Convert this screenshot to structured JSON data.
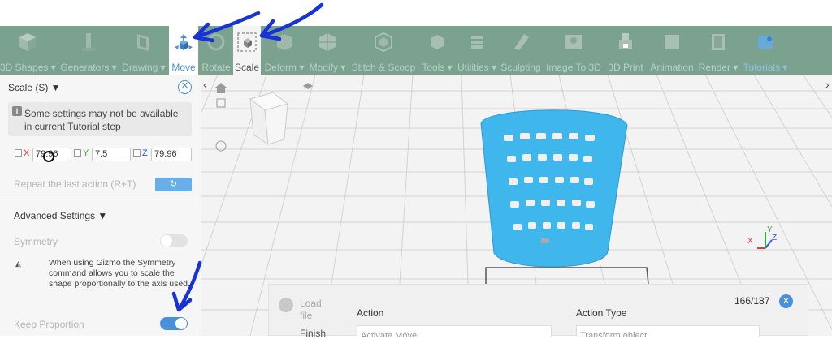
{
  "toolbar": {
    "items": [
      {
        "label": "3D Shapes ▾",
        "icon": "cube-icon"
      },
      {
        "label": "Generators ▾",
        "icon": "pillar-icon"
      },
      {
        "label": "Drawing ▾",
        "icon": "frame-icon"
      },
      {
        "label": "Move",
        "icon": "move-gizmo-icon"
      },
      {
        "label": "Rotate",
        "icon": "rotate-icon"
      },
      {
        "label": "Scale",
        "icon": "scale-icon"
      },
      {
        "label": "Deform ▾",
        "icon": "deform-icon"
      },
      {
        "label": "Modify ▾",
        "icon": "modify-icon"
      },
      {
        "label": "Stitch & Scoop",
        "icon": "stitch-icon"
      },
      {
        "label": "Tools ▾",
        "icon": "tools-icon"
      },
      {
        "label": "Utilities ▾",
        "icon": "layers-icon"
      },
      {
        "label": "Sculpting",
        "icon": "sculpt-icon"
      },
      {
        "label": "Image To 3D",
        "icon": "image-icon"
      },
      {
        "label": "3D Print",
        "icon": "printer-icon"
      },
      {
        "label": "Animation",
        "icon": "animation-icon"
      },
      {
        "label": "Render ▾",
        "icon": "render-icon"
      },
      {
        "label": "Tutorials ▾",
        "icon": "tutorial-icon"
      }
    ]
  },
  "panel": {
    "title": "Scale (S) ▼",
    "info": "Some settings may not be available in current Tutorial step",
    "x_label": "X",
    "x_value": "79.96",
    "y_label": "Y",
    "y_value": "7.5",
    "z_label": "Z",
    "z_value": "79.96",
    "repeat_label": "Repeat the last action (R+T)",
    "advanced": "Advanced Settings ▼",
    "symmetry": "Symmetry",
    "gizmo_note": "When using Gizmo the Symmetry command allows you to scale the shape proportionally to the axis used.",
    "keep_proportion": "Keep Proportion",
    "keep_proportion_on": true
  },
  "bottom": {
    "load_file": "Load file",
    "finish": "Finish",
    "action_header": "Action",
    "action_type_header": "Action Type",
    "action_value": "Activate Move",
    "action_type_value": "Transform object",
    "counter": "166/187"
  },
  "axes": {
    "x": "X",
    "y": "Y",
    "z": "Z"
  },
  "colors": {
    "toolbar": "#7aa28f",
    "accent": "#4a90d9",
    "mesh": "#3fb6ec"
  }
}
